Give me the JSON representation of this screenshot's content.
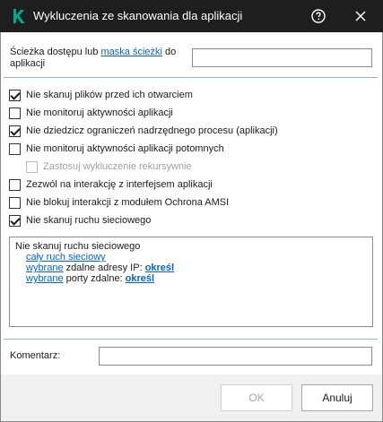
{
  "window": {
    "title": "Wykluczenia ze skanowania dla aplikacji",
    "logo_color": "#00a88e",
    "titlebar_color": "#1e1e1e"
  },
  "path": {
    "label_prefix": "Ścieżka dostępu lub ",
    "label_link": "maska ścieżki",
    "label_suffix": " do aplikacji",
    "value": ""
  },
  "options": [
    {
      "label": "Nie skanuj plików przed ich otwarciem",
      "checked": true,
      "disabled": false
    },
    {
      "label": "Nie monitoruj aktywności aplikacji",
      "checked": false,
      "disabled": false
    },
    {
      "label": "Nie dziedzicz ograniczeń nadrzędnego procesu (aplikacji)",
      "checked": true,
      "disabled": false
    },
    {
      "label": "Nie monitoruj aktywności aplikacji potomnych",
      "checked": false,
      "disabled": false
    },
    {
      "label": "Zastosuj wykluczenie rekursywnie",
      "checked": false,
      "disabled": true
    },
    {
      "label": "Zezwól na interakcję z interfejsem aplikacji",
      "checked": false,
      "disabled": false
    },
    {
      "label": "Nie blokuj interakcji z modułem Ochrona AMSI",
      "checked": false,
      "disabled": false
    },
    {
      "label": "Nie skanuj ruchu sieciowego",
      "checked": true,
      "disabled": false
    }
  ],
  "details": {
    "heading": "Nie skanuj ruchu sieciowego",
    "all_traffic_link": "cały ruch sieciowy",
    "selected_link_1": "wybrane",
    "remote_ip_text": " zdalne adresy IP: ",
    "specify_link_1": "określ",
    "selected_link_2": "wybrane",
    "remote_ports_text": " porty zdalne: ",
    "specify_link_2": "określ"
  },
  "comment": {
    "label": "Komentarz:",
    "value": ""
  },
  "buttons": {
    "ok_label": "OK",
    "cancel_label": "Anuluj"
  }
}
